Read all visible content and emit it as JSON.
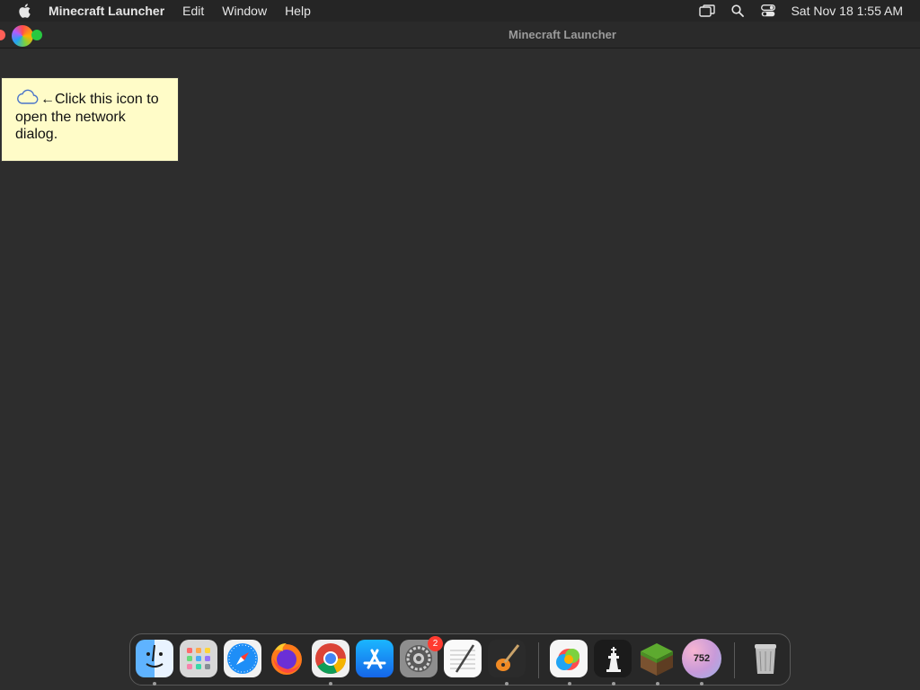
{
  "menubar": {
    "app_name": "Minecraft Launcher",
    "items": [
      "Edit",
      "Window",
      "Help"
    ],
    "clock": "Sat Nov 18  1:55 AM",
    "status_icons": [
      "screen-mirroring-icon",
      "spotlight-search-icon",
      "control-center-icon"
    ]
  },
  "window": {
    "title": "Minecraft Launcher"
  },
  "note": {
    "text": "←Click this icon to open the network dialog."
  },
  "dock": {
    "items": [
      {
        "name": "finder",
        "running": true
      },
      {
        "name": "launchpad",
        "running": false
      },
      {
        "name": "safari",
        "running": false
      },
      {
        "name": "firefox",
        "running": false
      },
      {
        "name": "chrome",
        "running": true
      },
      {
        "name": "app-store",
        "running": false
      },
      {
        "name": "system-settings",
        "running": false,
        "badge": "2"
      },
      {
        "name": "textedit",
        "running": false
      },
      {
        "name": "garageband",
        "running": true
      },
      {
        "name": "minecraft-launcher-color",
        "running": true
      },
      {
        "name": "chess",
        "running": true
      },
      {
        "name": "minecraft",
        "running": true
      },
      {
        "name": "counter-app",
        "running": true,
        "label": "752"
      },
      {
        "name": "trash",
        "running": false
      }
    ]
  },
  "colors": {
    "desktop": "#2d2d2d",
    "menubar": "#252525",
    "note_bg": "#fffcc8",
    "badge": "#ff3b30"
  }
}
